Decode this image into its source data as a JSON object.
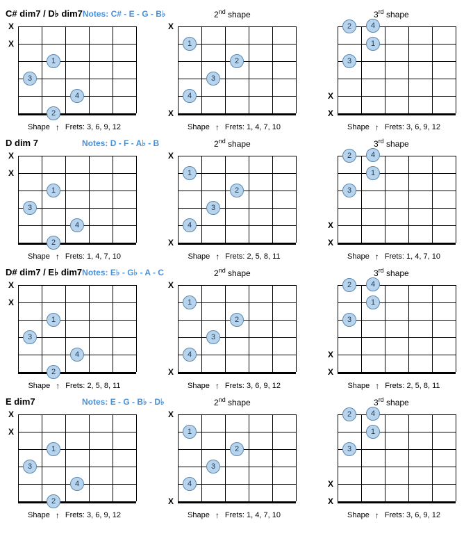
{
  "labels": {
    "notes_prefix": "Notes:",
    "shape2": "2",
    "shape2_suffix": "nd shape",
    "shape3": "3",
    "shape3_suffix": "rd shape",
    "footer_shape": "Shape",
    "footer_arrow": "↑",
    "footer_frets_prefix": "Frets:"
  },
  "shapes": {
    "s1": {
      "muted": [
        0,
        1
      ],
      "dots": [
        {
          "string": 2,
          "fret": 2,
          "finger": "1"
        },
        {
          "string": 3,
          "fret": 1,
          "finger": "3"
        },
        {
          "string": 4,
          "fret": 3,
          "finger": "4"
        },
        {
          "string": 3,
          "fret": 4,
          "finger": "2",
          "below": true
        }
      ]
    },
    "s2": {
      "muted": [
        0,
        5
      ],
      "dots": [
        {
          "string": 1,
          "fret": 1,
          "finger": "1"
        },
        {
          "string": 4,
          "fret": 1,
          "finger": "4"
        },
        {
          "string": 3,
          "fret": 2,
          "finger": "3"
        },
        {
          "string": 2,
          "fret": 3,
          "finger": "2"
        }
      ]
    },
    "s3": {
      "muted": [
        4,
        5
      ],
      "dots": [
        {
          "string": 2,
          "fret": 0,
          "finger": "4",
          "above": true
        },
        {
          "string": 0,
          "fret": 1,
          "finger": "2"
        },
        {
          "string": 2,
          "fret": 1,
          "finger": "3"
        },
        {
          "string": 1,
          "fret": 2,
          "finger": "1"
        }
      ]
    }
  },
  "rows": [
    {
      "name": "C# dim7 / D♭ dim7",
      "notes": "C# - E - G - B♭",
      "frets": [
        "3, 6, 9, 12",
        "1, 4, 7, 10",
        "3, 6, 9, 12"
      ]
    },
    {
      "name": "D dim 7",
      "notes": "D - F - A♭ - B",
      "frets": [
        "1, 4, 7, 10",
        "2, 5, 8, 11",
        "1, 4, 7, 10"
      ]
    },
    {
      "name": "D# dim7 / E♭ dim7",
      "notes": "E♭ - G♭ - A - C",
      "frets": [
        "2, 5, 8, 11",
        "3, 6, 9, 12",
        "2, 5, 8, 11"
      ]
    },
    {
      "name": "E dim7",
      "notes": "E - G - B♭ - D♭",
      "frets": [
        "3, 6, 9, 12",
        "1, 4, 7, 10",
        "3, 6, 9, 12"
      ]
    }
  ],
  "chart_data": {
    "type": "table",
    "description": "Guitar chord diagrams for diminished 7th chords. Three movable shapes per chord root.",
    "strings": 6,
    "frets_shown": 4,
    "columns": [
      "shape1",
      "shape2",
      "shape3"
    ],
    "shape_definitions": {
      "shape1": {
        "muted_strings": [
          6,
          5
        ],
        "fingering": [
          {
            "string": 4,
            "fret": 2,
            "finger": 1
          },
          {
            "string": 3,
            "fret": 1,
            "finger": 3
          },
          {
            "string": 2,
            "fret": 3,
            "finger": 4
          },
          {
            "string": 3,
            "fret": 4,
            "finger": 2,
            "below_grid": true
          }
        ]
      },
      "shape2": {
        "muted_strings": [
          6,
          1
        ],
        "fingering": [
          {
            "string": 5,
            "fret": 1,
            "finger": 1
          },
          {
            "string": 2,
            "fret": 1,
            "finger": 4
          },
          {
            "string": 3,
            "fret": 2,
            "finger": 3
          },
          {
            "string": 4,
            "fret": 3,
            "finger": 2
          }
        ]
      },
      "shape3": {
        "muted_strings": [
          2,
          1
        ],
        "fingering": [
          {
            "string": 4,
            "fret": 0,
            "finger": 4,
            "above_grid": true
          },
          {
            "string": 6,
            "fret": 1,
            "finger": 2
          },
          {
            "string": 4,
            "fret": 1,
            "finger": 3
          },
          {
            "string": 5,
            "fret": 2,
            "finger": 1
          }
        ]
      }
    },
    "rows": [
      {
        "root": "C#/Db",
        "notes": [
          "C#",
          "E",
          "G",
          "Bb"
        ],
        "shape_frets": {
          "shape1": [
            3,
            6,
            9,
            12
          ],
          "shape2": [
            1,
            4,
            7,
            10
          ],
          "shape3": [
            3,
            6,
            9,
            12
          ]
        }
      },
      {
        "root": "D",
        "notes": [
          "D",
          "F",
          "Ab",
          "B"
        ],
        "shape_frets": {
          "shape1": [
            1,
            4,
            7,
            10
          ],
          "shape2": [
            2,
            5,
            8,
            11
          ],
          "shape3": [
            1,
            4,
            7,
            10
          ]
        }
      },
      {
        "root": "D#/Eb",
        "notes": [
          "Eb",
          "Gb",
          "A",
          "C"
        ],
        "shape_frets": {
          "shape1": [
            2,
            5,
            8,
            11
          ],
          "shape2": [
            3,
            6,
            9,
            12
          ],
          "shape3": [
            2,
            5,
            8,
            11
          ]
        }
      },
      {
        "root": "E",
        "notes": [
          "E",
          "G",
          "Bb",
          "Db"
        ],
        "shape_frets": {
          "shape1": [
            3,
            6,
            9,
            12
          ],
          "shape2": [
            1,
            4,
            7,
            10
          ],
          "shape3": [
            3,
            6,
            9,
            12
          ]
        }
      }
    ]
  }
}
